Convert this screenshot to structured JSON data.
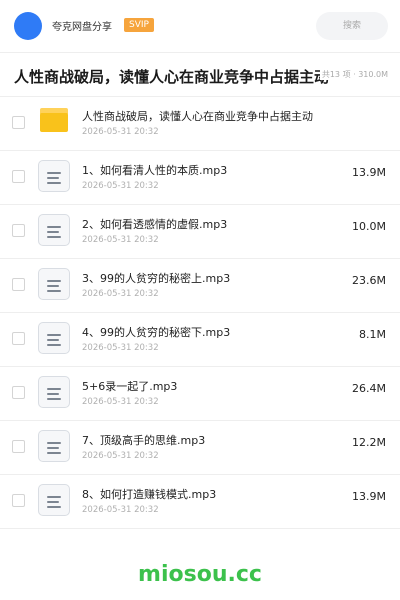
{
  "header": {
    "owner_name": "夸克网盘分享",
    "badge": "SVIP",
    "search_placeholder": "搜索"
  },
  "folder": {
    "title": "人性商战破局，读懂人心在商业竞争中占据主动",
    "meta": "共13 项 · 310.0M"
  },
  "items": [
    {
      "type": "folder",
      "name": "人性商战破局，读懂人心在商业竞争中占据主动",
      "date": "2026-05-31 20:32",
      "size": ""
    },
    {
      "type": "file",
      "name": "1、如何看清人性的本质.mp3",
      "date": "2026-05-31 20:32",
      "size": "13.9M"
    },
    {
      "type": "file",
      "name": "2、如何看透感情的虚假.mp3",
      "date": "2026-05-31 20:32",
      "size": "10.0M"
    },
    {
      "type": "file",
      "name": "3、99的人贫穷的秘密上.mp3",
      "date": "2026-05-31 20:32",
      "size": "23.6M"
    },
    {
      "type": "file",
      "name": "4、99的人贫穷的秘密下.mp3",
      "date": "2026-05-31 20:32",
      "size": "8.1M"
    },
    {
      "type": "file",
      "name": "5+6录一起了.mp3",
      "date": "2026-05-31 20:32",
      "size": "26.4M"
    },
    {
      "type": "file",
      "name": "7、顶级高手的思维.mp3",
      "date": "2026-05-31 20:32",
      "size": "12.2M"
    },
    {
      "type": "file",
      "name": "8、如何打造赚钱模式.mp3",
      "date": "2026-05-31 20:32",
      "size": "13.9M"
    }
  ],
  "watermark": "miosou.cc",
  "colors": {
    "avatar": "#2f7bf6",
    "svip_badge": "#f6a43c",
    "folder_icon": "#f9c21b",
    "watermark": "#3cc14c"
  }
}
